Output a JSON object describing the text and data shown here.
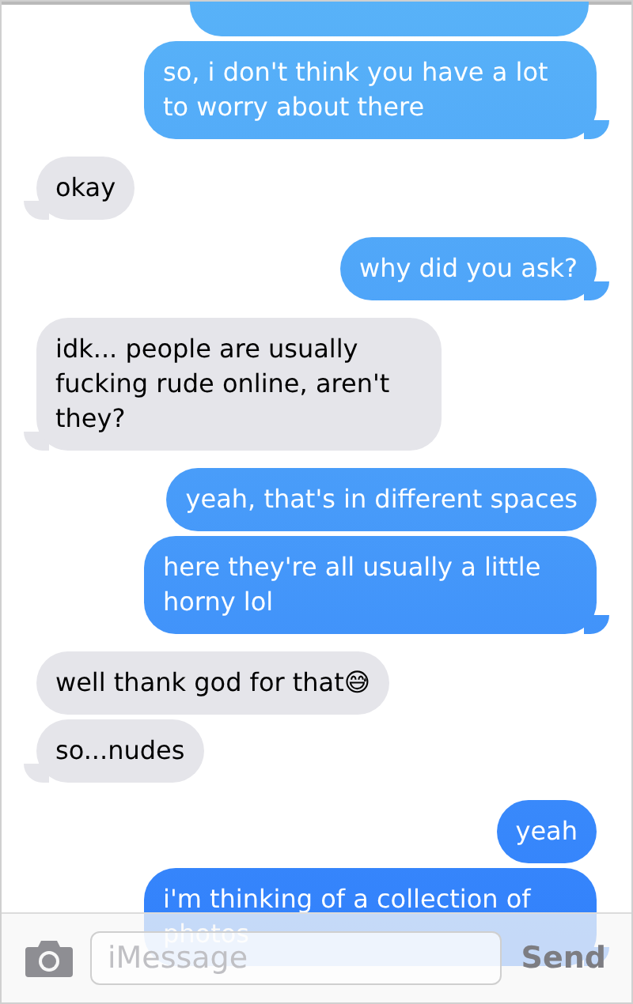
{
  "messages": [
    {
      "kind": "clipped",
      "sent": true
    },
    {
      "kind": "text",
      "sent": true,
      "text": "so, i don't think you have a lot to worry about there",
      "tail": true
    },
    {
      "kind": "text",
      "sent": false,
      "text": "okay",
      "tail": true
    },
    {
      "kind": "text",
      "sent": true,
      "text": "why did you ask?",
      "tail": true
    },
    {
      "kind": "text",
      "sent": false,
      "text": "idk... people are usually fucking rude online, aren't they?",
      "tail": true
    },
    {
      "kind": "text",
      "sent": true,
      "text": "yeah, that's in different spaces",
      "tail": false
    },
    {
      "kind": "text",
      "sent": true,
      "text": "here they're all usually a little horny lol",
      "tail": true
    },
    {
      "kind": "text",
      "sent": false,
      "text": "well thank god for that😅",
      "tail": false
    },
    {
      "kind": "text",
      "sent": false,
      "text": "so...nudes",
      "tail": true
    },
    {
      "kind": "text",
      "sent": true,
      "text": "yeah",
      "tail": false
    },
    {
      "kind": "text",
      "sent": true,
      "text": "i'm thinking of a collection of photos",
      "tail": true
    }
  ],
  "composer": {
    "placeholder": "iMessage",
    "send": "Send"
  }
}
